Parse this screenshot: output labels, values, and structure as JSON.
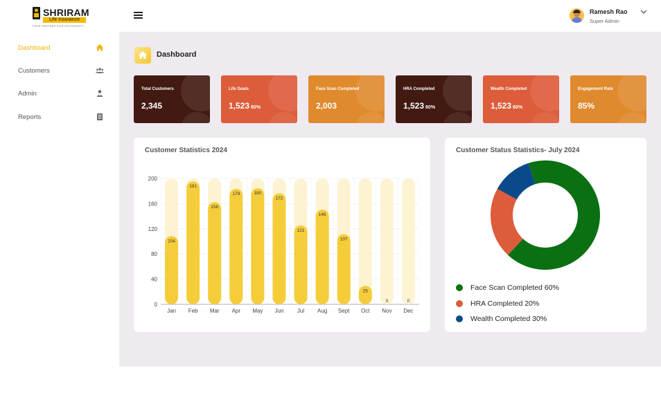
{
  "brand": {
    "name": "SHRIRAM",
    "sub": "Life Insurance",
    "tagline": "YOUR PARTNER FOR PROSPERITY",
    "color": "#f5b800"
  },
  "user": {
    "name": "Ramesh Rao",
    "role": "Super Admin"
  },
  "sidebar": {
    "items": [
      {
        "label": "Dashboard",
        "icon": "home-icon",
        "active": true
      },
      {
        "label": "Customers",
        "icon": "users-icon",
        "active": false
      },
      {
        "label": "Admin",
        "icon": "user-admin-icon",
        "active": false
      },
      {
        "label": "Reports",
        "icon": "report-icon",
        "active": false
      }
    ],
    "active_color": "#f0b400"
  },
  "page": {
    "title": "Dashboard"
  },
  "cards": [
    {
      "title": "Total Customers",
      "value": "2,345",
      "pct": "",
      "color": "#421a12"
    },
    {
      "title": "Life Goals",
      "value": "1,523",
      "pct": "60%",
      "color": "#dd5c3a"
    },
    {
      "title": "Face Scan Completed",
      "value": "2,003",
      "pct": "",
      "color": "#e08a2e"
    },
    {
      "title": "HRA Completed",
      "value": "1,523",
      "pct": "60%",
      "color": "#421a12"
    },
    {
      "title": "Wealth Completed",
      "value": "1,523",
      "pct": "60%",
      "color": "#dd5c3a"
    },
    {
      "title": "Engagement Rate",
      "value": "85%",
      "pct": "",
      "color": "#e08a2e"
    }
  ],
  "bar_panel": {
    "title": "Customer Statistics 2024"
  },
  "donut_panel": {
    "title": "Customer Status Statistics- July 2024",
    "legend": [
      {
        "label": "Face Scan Completed 60%",
        "color": "#0a7012"
      },
      {
        "label": "HRA Completed 20%",
        "color": "#dd5c3a"
      },
      {
        "label": "Wealth Completed 30%",
        "color": "#0b4a8a"
      }
    ]
  },
  "chart_data": [
    {
      "type": "bar",
      "title": "Customer Statistics 2024",
      "categories": [
        "Jan",
        "Feb",
        "Mar",
        "Apr",
        "May",
        "Jun",
        "Jul",
        "Aug",
        "Sept",
        "Oct",
        "Nov",
        "Dec"
      ],
      "values": [
        104,
        191,
        158,
        179,
        180,
        172,
        121,
        146,
        107,
        25,
        0,
        0
      ],
      "yticks": [
        0,
        40,
        80,
        120,
        160,
        200
      ],
      "ylim": [
        0,
        200
      ],
      "bar_color": "#f5cd3a",
      "track_color": "#fdf3d2",
      "grid": true
    },
    {
      "type": "pie",
      "title": "Customer Status Statistics- July 2024",
      "labels": [
        "Face Scan Completed",
        "HRA Completed",
        "Wealth Completed"
      ],
      "values": [
        0.67,
        0.21,
        0.12
      ],
      "colors": [
        "#0a7012",
        "#dd5c3a",
        "#0b4a8a"
      ],
      "donut": true
    }
  ]
}
